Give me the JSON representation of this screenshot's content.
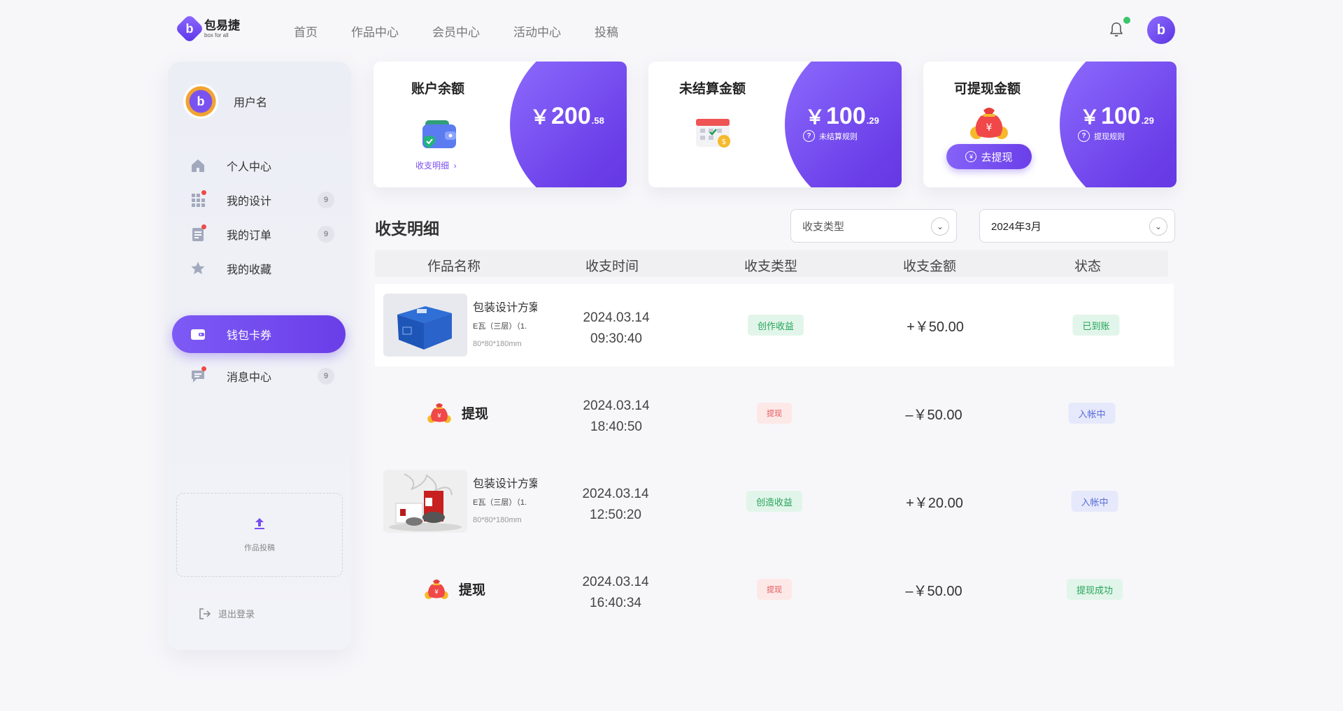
{
  "header": {
    "logo_cn": "包易捷",
    "logo_en": "box for all",
    "nav": [
      "首页",
      "作品中心",
      "会员中心",
      "活动中心",
      "投稿"
    ]
  },
  "sidebar": {
    "username": "用户名",
    "items": [
      {
        "label": "个人中心",
        "badge": ""
      },
      {
        "label": "我的设计",
        "badge": "9"
      },
      {
        "label": "我的订单",
        "badge": "9"
      },
      {
        "label": "我的收藏",
        "badge": ""
      },
      {
        "label": "钱包卡券",
        "badge": ""
      },
      {
        "label": "消息中心",
        "badge": "9"
      }
    ],
    "upload_label": "作品投稿",
    "logout_label": "退出登录"
  },
  "cards": {
    "balance": {
      "title": "账户余额",
      "currency": "￥",
      "int": "200",
      "dec": ".58",
      "link": "收支明细"
    },
    "unsettled": {
      "title": "未结算金额",
      "currency": "￥",
      "int": "100",
      "dec": ".29",
      "rule": "未结算规则"
    },
    "withdrawable": {
      "title": "可提现金额",
      "currency": "￥",
      "int": "100",
      "dec": ".29",
      "rule": "提现规则",
      "button": "去提现"
    }
  },
  "detail": {
    "title": "收支明细",
    "type_select": "收支类型",
    "month_select": "2024年3月",
    "columns": [
      "作品名称",
      "收支时间",
      "收支类型",
      "收支金额",
      "状态"
    ],
    "rows": [
      {
        "kind": "product",
        "name": "包装设计方案",
        "spec": "E瓦（三层）（1.",
        "size": "80*80*180mm",
        "date": "2024.03.14",
        "time": "09:30:40",
        "type": "创作收益",
        "amount": "+￥50.00",
        "status": "已到账"
      },
      {
        "kind": "withdraw",
        "name": "提现",
        "date": "2024.03.14",
        "time": "18:40:50",
        "type": "提现",
        "amount": "–￥50.00",
        "status": "入帐中"
      },
      {
        "kind": "product",
        "name": "包装设计方案",
        "spec": "E瓦（三层）（1.",
        "size": "80*80*180mm",
        "date": "2024.03.14",
        "time": "12:50:20",
        "type": "创造收益",
        "amount": "+￥20.00",
        "status": "入帐中"
      },
      {
        "kind": "withdraw",
        "name": "提现",
        "date": "2024.03.14",
        "time": "16:40:34",
        "type": "提现",
        "amount": "–￥50.00",
        "status": "提现成功"
      }
    ]
  },
  "colors": {
    "accent": "#6a3ee8",
    "green": "#23a458",
    "red": "#e35a5a",
    "blue": "#5a6bd9",
    "online": "#3bc46b"
  }
}
